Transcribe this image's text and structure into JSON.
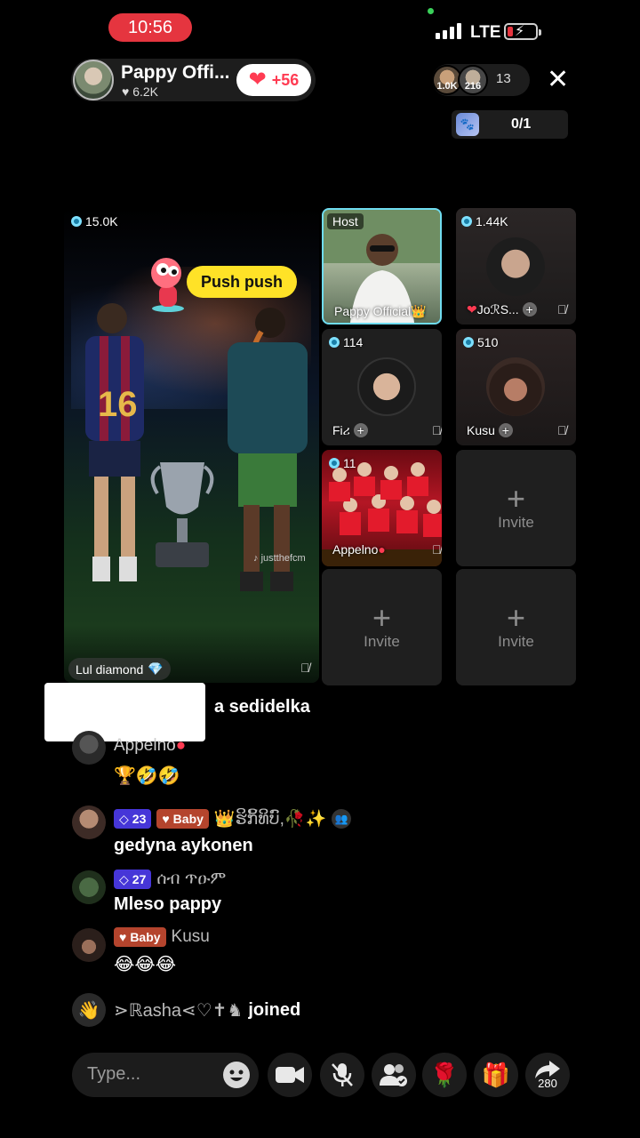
{
  "status_bar": {
    "time": "10:56",
    "network": "LTE"
  },
  "header": {
    "host_name": "Pappy Offi...",
    "host_likes": "6.2K",
    "like_increment": "+56",
    "viewer_badges": [
      "1.0K",
      "216"
    ],
    "viewer_count": "13",
    "pk_count": "0/1"
  },
  "main_tile": {
    "score": "15.0K",
    "push_label": "Push push",
    "name": "Lul diamond",
    "watermark": "justthefcm"
  },
  "guest_tiles": [
    {
      "badge": "Host",
      "name": "Pappy Official"
    },
    {
      "score": "1.44K",
      "name": "JoℛS..."
    },
    {
      "score": "114",
      "name": "Fiሪ"
    },
    {
      "score": "510",
      "name": "Kusu"
    },
    {
      "score": "11",
      "name": "Appelno"
    }
  ],
  "invite_label": "Invite",
  "chat": {
    "partial_message": "a sedidelka",
    "messages": [
      {
        "name": "Appelno",
        "text": "🏆🤣🤣"
      },
      {
        "level": "23",
        "badge": "Baby",
        "name": "👑ຮິກິ້ທິບົ,🥀✨",
        "text": "gedyna aykonen"
      },
      {
        "level": "27",
        "name": "ሰብ ጥዑም",
        "text": "Mleso pappy"
      },
      {
        "badge": "Baby",
        "name": "Kusu",
        "text": "😂😂😂"
      }
    ],
    "joined": {
      "name": "⋗ℝasha⋖♡✝♞",
      "action": "joined"
    }
  },
  "bottom_bar": {
    "placeholder": "Type...",
    "share_count": "280"
  },
  "colors": {
    "accent": "#ff3b52",
    "time_pill": "#e5353f",
    "host_border": "#6fdcf0",
    "push": "#ffe227"
  }
}
